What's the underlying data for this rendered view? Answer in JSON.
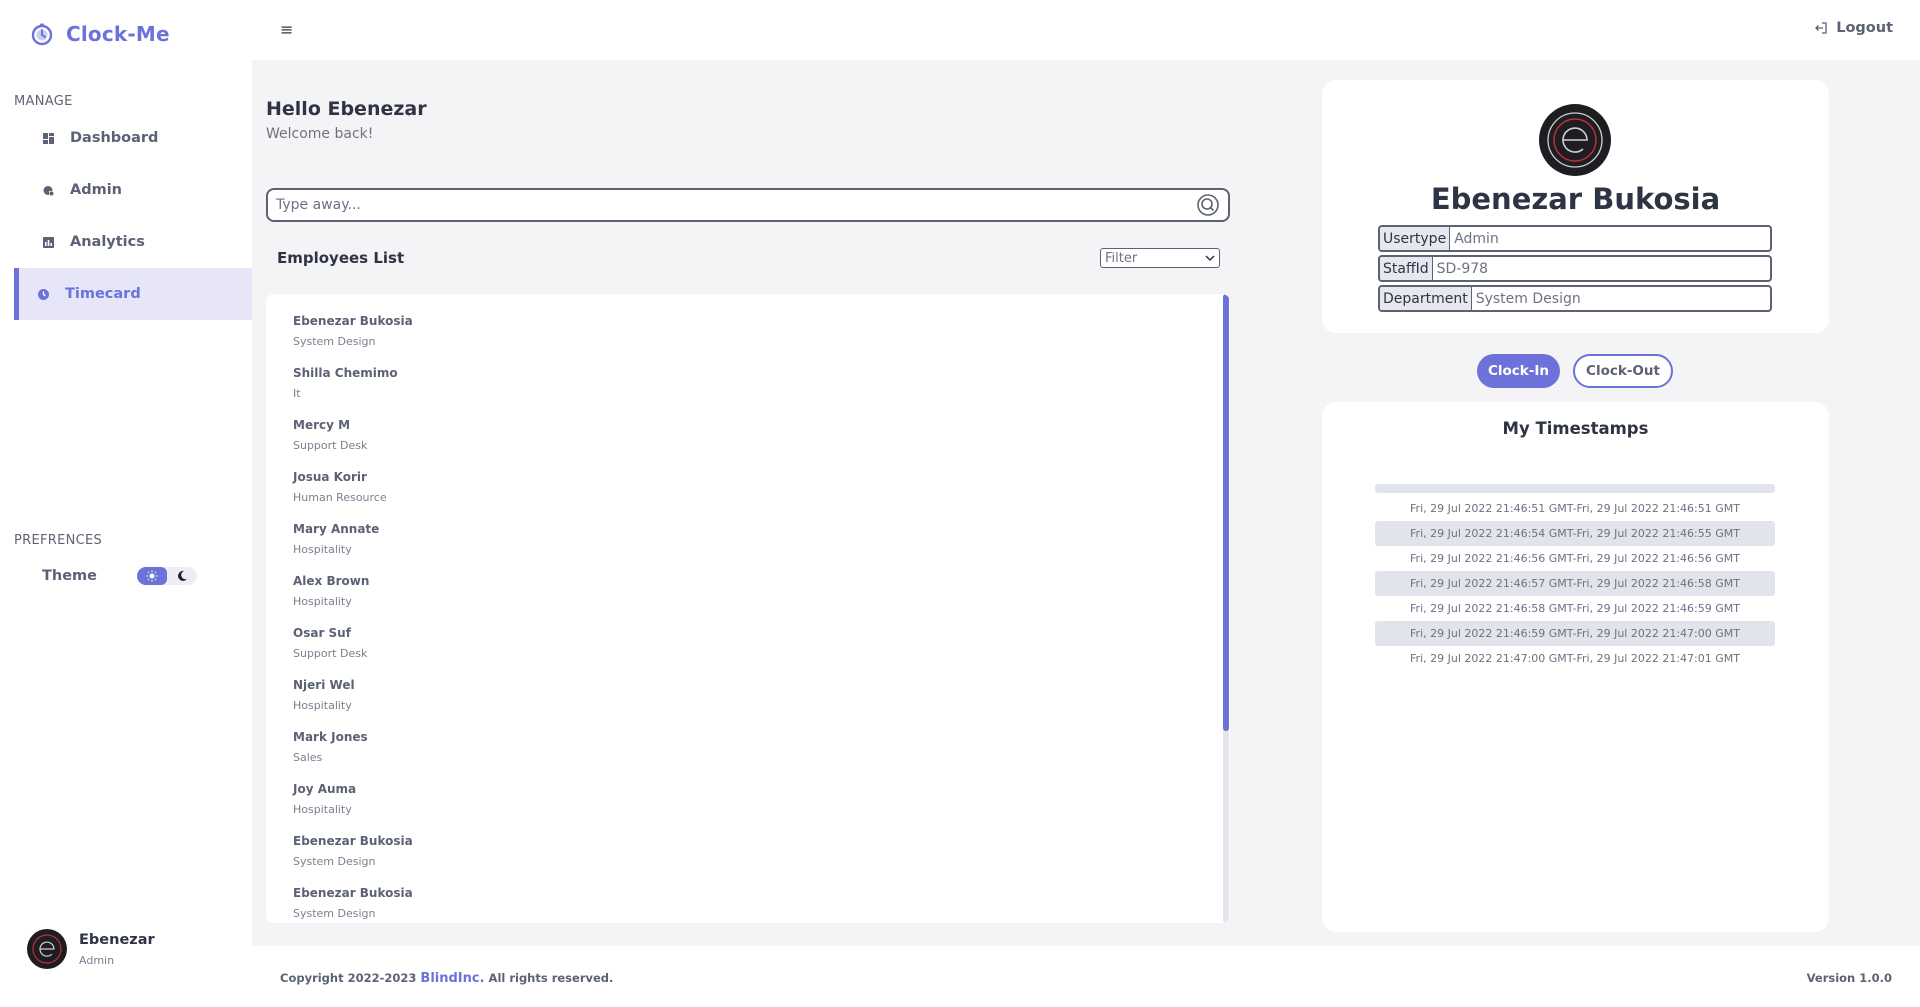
{
  "app": {
    "name": "Clock-Me"
  },
  "sidebar": {
    "manage_title": "MANAGE",
    "items": [
      {
        "label": "Dashboard",
        "icon": "dashboard-icon"
      },
      {
        "label": "Admin",
        "icon": "admin-icon"
      },
      {
        "label": "Analytics",
        "icon": "analytics-icon"
      },
      {
        "label": "Timecard",
        "icon": "clock-icon",
        "active": true
      }
    ],
    "preferences_title": "PREFRENCES",
    "theme_label": "Theme",
    "theme_selected": "light"
  },
  "user": {
    "name": "Ebenezar",
    "role": "Admin"
  },
  "topbar": {
    "logout_label": "Logout"
  },
  "main": {
    "greeting": "Hello Ebenezar",
    "welcome": "Welcome back!",
    "search_placeholder": "Type away...",
    "list_title": "Employees List",
    "filter_label": "Filter",
    "employees": [
      {
        "name": "Ebenezar Bukosia",
        "dept": "System Design"
      },
      {
        "name": "Shilla Chemimo",
        "dept": "It"
      },
      {
        "name": "Mercy M",
        "dept": "Support Desk"
      },
      {
        "name": "Josua Korir",
        "dept": "Human Resource"
      },
      {
        "name": "Mary Annate",
        "dept": "Hospitality"
      },
      {
        "name": "Alex Brown",
        "dept": "Hospitality"
      },
      {
        "name": "Osar Suf",
        "dept": "Support Desk"
      },
      {
        "name": "Njeri Wel",
        "dept": "Hospitality"
      },
      {
        "name": "Mark Jones",
        "dept": "Sales"
      },
      {
        "name": "Joy Auma",
        "dept": "Hospitality"
      },
      {
        "name": "Ebenezar Bukosia",
        "dept": "System Design"
      },
      {
        "name": "Ebenezar Bukosia",
        "dept": "System Design"
      }
    ]
  },
  "profile_card": {
    "full_name": "Ebenezar Bukosia",
    "fields": [
      {
        "label": "Usertype",
        "value": "Admin"
      },
      {
        "label": "StaffId",
        "value": "SD-978"
      },
      {
        "label": "Department",
        "value": "System Design"
      }
    ]
  },
  "actions": {
    "clock_in": "Clock-In",
    "clock_out": "Clock-Out"
  },
  "timestamps": {
    "title": "My Timestamps",
    "rows": [
      "Fri, 29 Jul 2022 21:46:51 GMT-Fri, 29 Jul 2022 21:46:51 GMT",
      "Fri, 29 Jul 2022 21:46:54 GMT-Fri, 29 Jul 2022 21:46:55 GMT",
      "Fri, 29 Jul 2022 21:46:56 GMT-Fri, 29 Jul 2022 21:46:56 GMT",
      "Fri, 29 Jul 2022 21:46:57 GMT-Fri, 29 Jul 2022 21:46:58 GMT",
      "Fri, 29 Jul 2022 21:46:58 GMT-Fri, 29 Jul 2022 21:46:59 GMT",
      "Fri, 29 Jul 2022 21:46:59 GMT-Fri, 29 Jul 2022 21:47:00 GMT",
      "Fri, 29 Jul 2022 21:47:00 GMT-Fri, 29 Jul 2022 21:47:01 GMT"
    ]
  },
  "footer": {
    "copyright_prefix": "Copyright 2022-2023",
    "brand": "BlindInc.",
    "copyright_suffix": "All rights reserved.",
    "version": "Version 1.0.0"
  },
  "colors": {
    "accent": "#6c72d9",
    "text": "#2f3445",
    "background": "#f4f4f6"
  }
}
